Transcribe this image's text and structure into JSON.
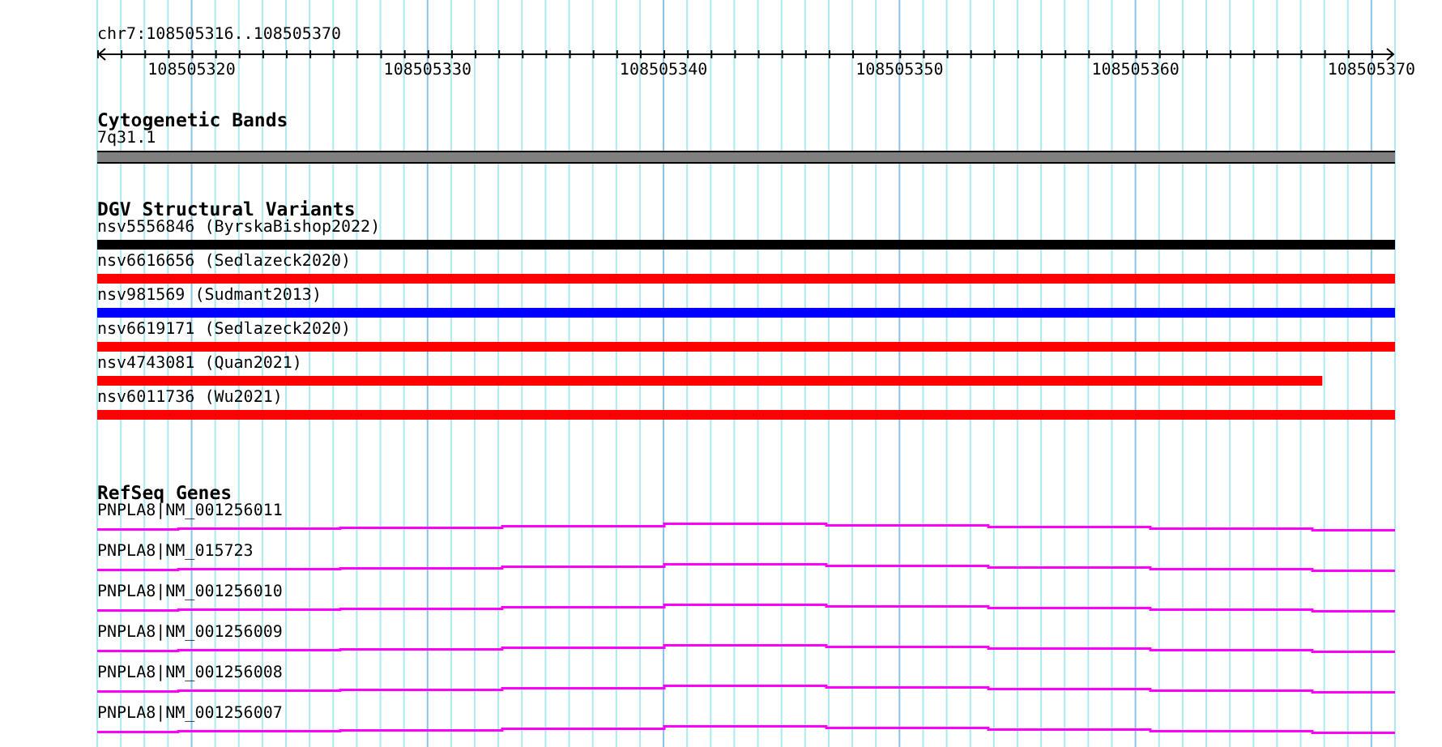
{
  "location": "chr7:108505316..108505370",
  "ruler": {
    "tick_labels": [
      "108505320",
      "108505330",
      "108505340",
      "108505350",
      "108505360",
      "108505370"
    ]
  },
  "tracks": [
    {
      "kind": "band",
      "title": "Cytogenetic Bands",
      "features": [
        {
          "label": "7q31.1"
        }
      ]
    },
    {
      "kind": "variant",
      "title": "DGV Structural Variants",
      "features": [
        {
          "label": "nsv5556846 (ByrskaBishop2022)",
          "color": "#000000",
          "level": 1
        },
        {
          "label": "nsv6616656 (Sedlazeck2020)",
          "color": "#ff0000",
          "level": 1
        },
        {
          "label": "nsv981569 (Sudmant2013)",
          "color": "#0000ff",
          "level": 1
        },
        {
          "label": "nsv6619171 (Sedlazeck2020)",
          "color": "#ff0000",
          "level": 1
        },
        {
          "label": "nsv4743081 (Quan2021)",
          "color": "#ff0000",
          "level": 0.944
        },
        {
          "label": "nsv6011736 (Wu2021)",
          "color": "#ff0000",
          "level": 1
        }
      ]
    },
    {
      "kind": "gene",
      "title": "RefSeq Genes",
      "features": [
        {
          "label": "PNPLA8|NM_001256011"
        },
        {
          "label": "PNPLA8|NM_015723"
        },
        {
          "label": "PNPLA8|NM_001256010"
        },
        {
          "label": "PNPLA8|NM_001256009"
        },
        {
          "label": "PNPLA8|NM_001256008"
        },
        {
          "label": "PNPLA8|NM_001256007"
        }
      ]
    }
  ]
}
